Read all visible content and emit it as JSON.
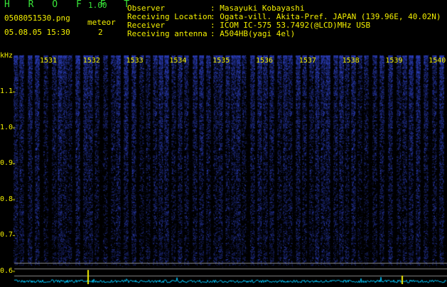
{
  "header": {
    "app_title": "H R O F F T",
    "app_version": "1.00",
    "file_name": "0508051530.png",
    "mode_label": "meteor",
    "mode_value": "2",
    "date_time": "05.08.05 15:30"
  },
  "meta": [
    {
      "label": "Observer",
      "value": ": Masayuki Kobayashi"
    },
    {
      "label": "Receiving Location",
      "value": ": Ogata-vill. Akita-Pref. JAPAN (139.96E, 40.02N)"
    },
    {
      "label": "Receiver",
      "value": ": ICOM IC-575 53.7492(@LCD)MHz USB"
    },
    {
      "label": "Receiving antenna",
      "value": ": A504HB(yagi 4el)"
    }
  ],
  "axis": {
    "y_unit": "kHz",
    "y_ticks": [
      "1.1",
      "1.0",
      "0.9",
      "0.8",
      "0.7",
      "0.6"
    ],
    "x_ticks": [
      "1531",
      "1532",
      "1533",
      "1534",
      "1535",
      "1536",
      "1537",
      "1538",
      "1539",
      "1540"
    ]
  },
  "colors": {
    "background": "#000000",
    "text_green": "#39e639",
    "text_yellow": "#f4f000",
    "signal": "#2a3cff",
    "trace": "#00c8ff"
  }
}
